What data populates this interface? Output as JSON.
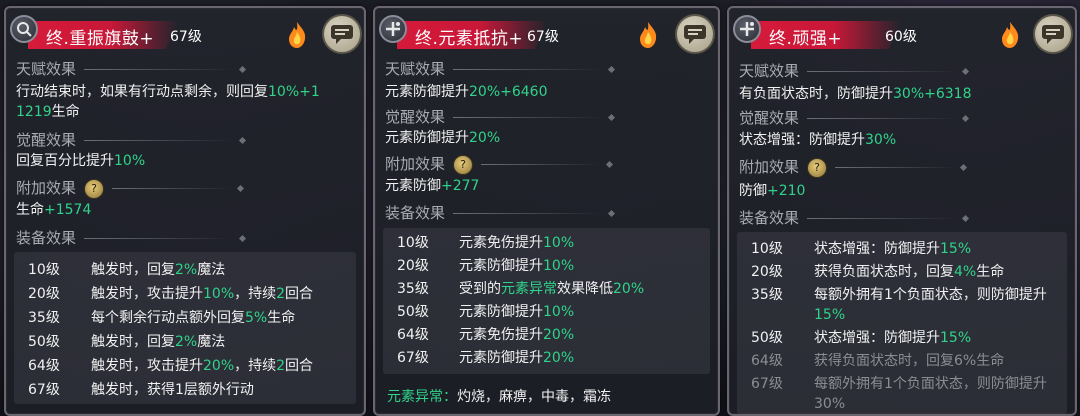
{
  "panels": [
    {
      "title": "终.重振旗鼓+",
      "level": "67级",
      "talent_label": "天赋效果",
      "talent_text_parts": [
        "行动结束时，如果有行动点剩余，则回复",
        "10%+1",
        "1219",
        "生命"
      ],
      "awaken_label": "觉醒效果",
      "awaken_parts": [
        "回复百分比提升",
        "10%"
      ],
      "bonus_label": "附加效果",
      "bonus_parts": [
        "生命",
        "+1574"
      ],
      "equip_label": "装备效果",
      "equip": [
        {
          "lv": "10级",
          "parts": [
            "触发时，回复",
            "2%",
            "魔法"
          ]
        },
        {
          "lv": "20级",
          "parts": [
            "触发时，攻击提升",
            "10%",
            "，持续",
            "2",
            "回合"
          ]
        },
        {
          "lv": "35级",
          "parts": [
            "每个剩余行动点额外回复",
            "5%",
            "生命"
          ]
        },
        {
          "lv": "50级",
          "parts": [
            "触发时，回复",
            "2%",
            "魔法"
          ]
        },
        {
          "lv": "64级",
          "parts": [
            "触发时，攻击提升",
            "20%",
            "，持续",
            "2",
            "回合"
          ]
        },
        {
          "lv": "67级",
          "parts": [
            "触发时，获得1层额外行动"
          ]
        }
      ]
    },
    {
      "title": "终.元素抵抗+",
      "level": "67级",
      "talent_label": "天赋效果",
      "talent_parts": [
        "元素防御提升",
        "20%+6460"
      ],
      "awaken_label": "觉醒效果",
      "awaken_parts": [
        "元素防御提升",
        "20%"
      ],
      "bonus_label": "附加效果",
      "bonus_parts": [
        "元素防御",
        "+277"
      ],
      "equip_label": "装备效果",
      "equip": [
        {
          "lv": "10级",
          "parts": [
            "元素免伤提升",
            "10%"
          ]
        },
        {
          "lv": "20级",
          "parts": [
            "元素防御提升",
            "10%"
          ]
        },
        {
          "lv": "35级",
          "parts": [
            "受到的",
            "元素异常",
            "效果降低",
            "20%"
          ]
        },
        {
          "lv": "50级",
          "parts": [
            "元素防御提升",
            "10%"
          ]
        },
        {
          "lv": "64级",
          "parts": [
            "元素免伤提升",
            "20%"
          ]
        },
        {
          "lv": "67级",
          "parts": [
            "元素防御提升",
            "20%"
          ]
        }
      ],
      "footer_parts": [
        "元素异常：",
        "灼烧，麻痹，中毒，霜冻"
      ]
    },
    {
      "title": "终.顽强+",
      "level": "60级",
      "talent_label": "天赋效果",
      "talent_parts": [
        "有负面状态时，防御提升",
        "30%+6318"
      ],
      "awaken_label": "觉醒效果",
      "awaken_parts": [
        "状态增强：防御提升",
        "30%"
      ],
      "bonus_label": "附加效果",
      "bonus_parts": [
        "防御",
        "+210"
      ],
      "equip_label": "装备效果",
      "equip": [
        {
          "lv": "10级",
          "parts": [
            "状态增强：防御提升",
            "15%"
          ],
          "dim": false
        },
        {
          "lv": "20级",
          "parts": [
            "获得负面状态时，回复",
            "4%",
            "生命"
          ],
          "dim": false
        },
        {
          "lv": "35级",
          "parts": [
            "每额外拥有1个负面状态，则防御提升",
            "15%"
          ],
          "dim": false
        },
        {
          "lv": "50级",
          "parts": [
            "状态增强：防御提升",
            "15%"
          ],
          "dim": false
        },
        {
          "lv": "64级",
          "parts": [
            "获得负面状态时，回复6%生命"
          ],
          "dim": true
        },
        {
          "lv": "67级",
          "parts": [
            "每额外拥有1个负面状态，则防御提升30%"
          ],
          "dim": true
        }
      ]
    }
  ],
  "colors": {
    "title_bar": "#d61a3a",
    "highlight_green": "#2fd38a",
    "section_gray": "#a9acb3",
    "dim_text": "#8b8d93"
  },
  "icons": [
    "skill-badge-icon",
    "flame-icon",
    "chat-bubble-icon",
    "awaken-rune-icon"
  ]
}
